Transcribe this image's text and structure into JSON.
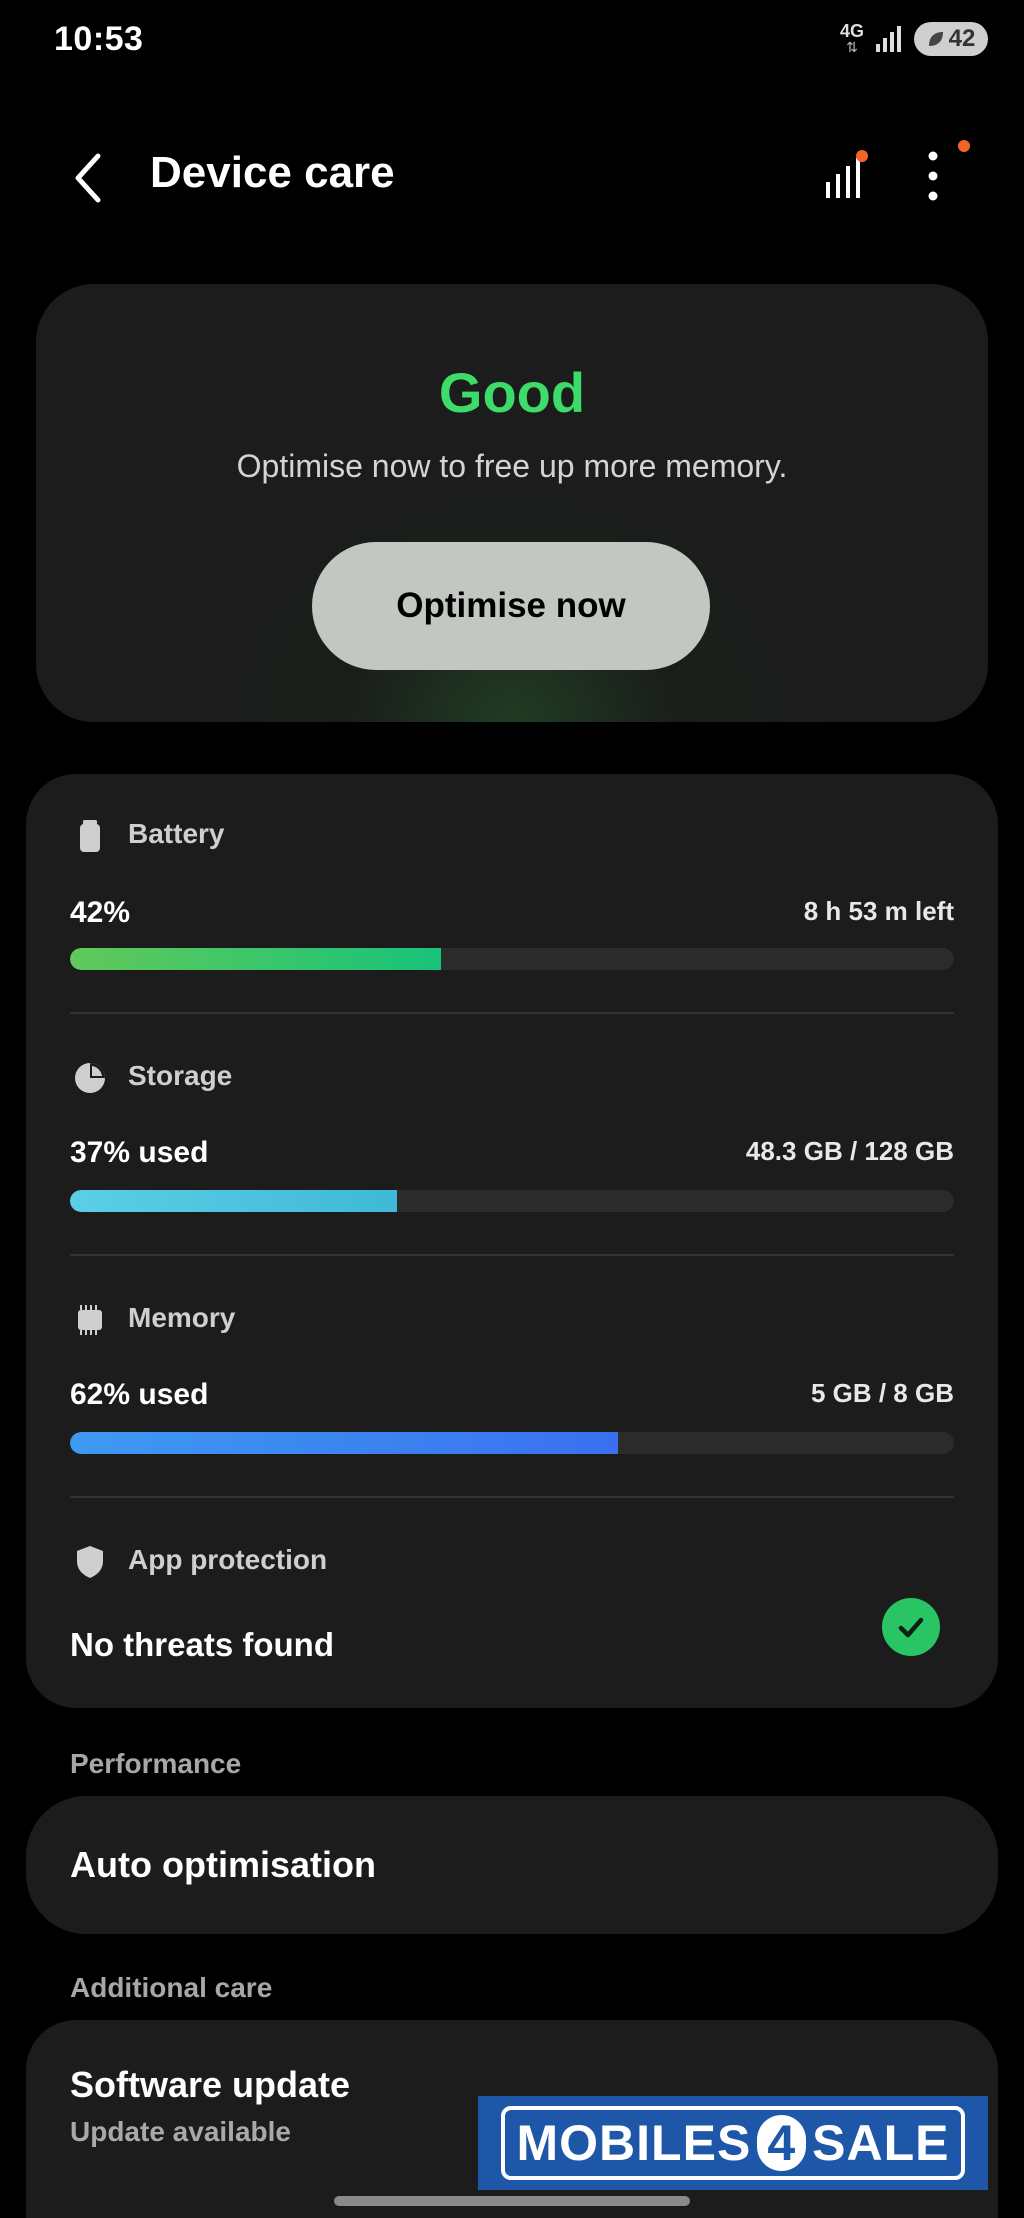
{
  "status_bar": {
    "time": "10:53",
    "network_type": "4G",
    "network_arrows": "⇅",
    "battery_level": "42"
  },
  "header": {
    "title": "Device care",
    "back_icon": "chevron-left-icon",
    "stats_icon": "signal-bars-icon",
    "more_icon": "more-vertical-icon",
    "notification_dot_color": "#f26522"
  },
  "status": {
    "state": "Good",
    "state_color": "#3ddb6a",
    "message": "Optimise now to free up more memory.",
    "button_label": "Optimise now"
  },
  "battery": {
    "title": "Battery",
    "value": "42%",
    "detail": "8 h 53 m left",
    "level": 0.42,
    "color": "#2ecc71"
  },
  "storage": {
    "title": "Storage",
    "value": "37% used",
    "detail": "48.3 GB / 128 GB",
    "level": 0.37,
    "color": "#4fc3e0"
  },
  "memory": {
    "title": "Memory",
    "value": "62% used",
    "detail": "5 GB / 8 GB",
    "level": 0.62,
    "color": "#3d86f0"
  },
  "app_protection": {
    "title": "App protection",
    "value": "No threats found"
  },
  "performance": {
    "label": "Performance",
    "item": "Auto optimisation"
  },
  "additional_care": {
    "label": "Additional care",
    "item_title": "Software update",
    "item_subtitle": "Update available"
  },
  "watermark": {
    "text_left": "MOBILES",
    "text_mid": "4",
    "text_right": "SALE"
  }
}
